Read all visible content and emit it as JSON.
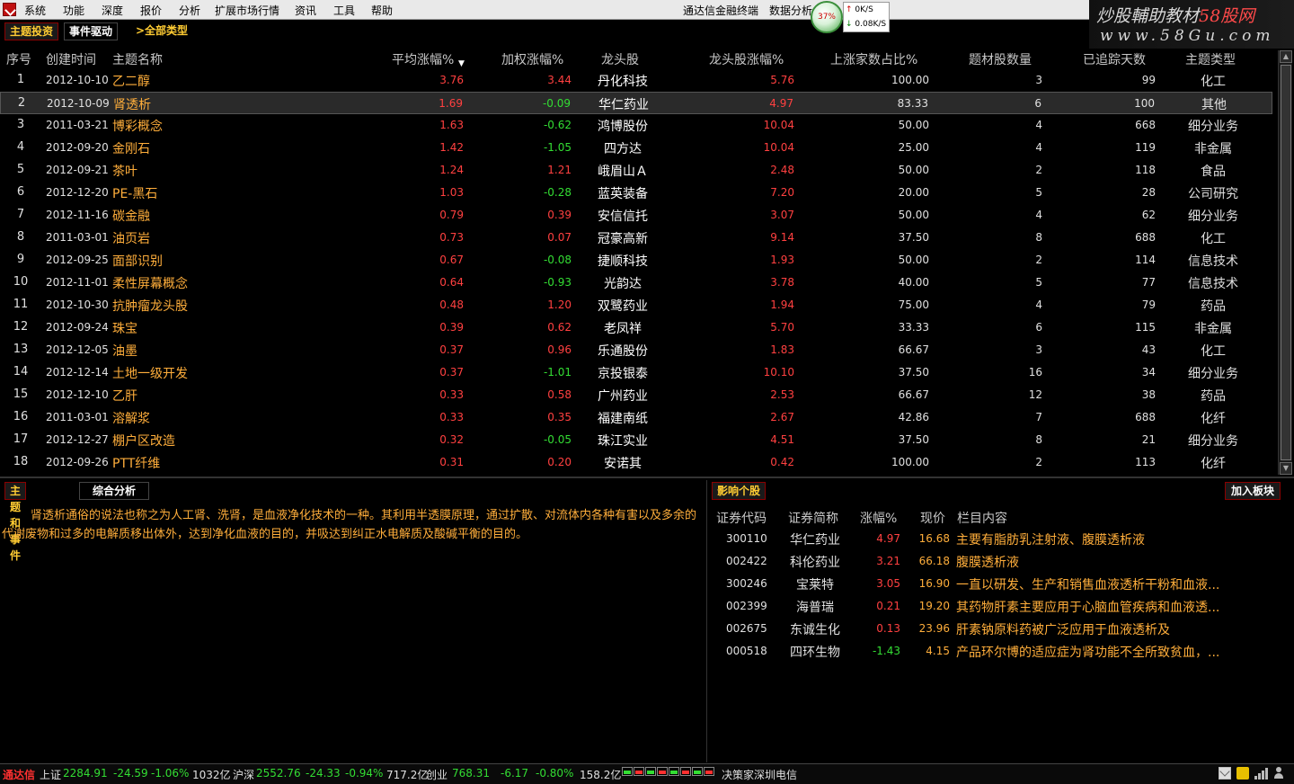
{
  "menu": {
    "items": [
      "系统",
      "功能",
      "深度",
      "报价",
      "分析",
      "扩展市场行情",
      "资讯",
      "工具",
      "帮助"
    ],
    "right_items": [
      "通达信金融终端",
      "数据分析"
    ],
    "speed_gauge": "37%",
    "speed_up": "0K/S",
    "speed_down": "0.08K/S"
  },
  "watermark": {
    "line1_a": "炒股輔助教材",
    "line1_b": "58",
    "line1_c": "股网",
    "line2": "www.58Gu.com"
  },
  "tabs": {
    "theme_invest": "主题投资",
    "event_driven": "事件驱动",
    "all_types": ">全部类型"
  },
  "table": {
    "headers": {
      "idx": "序号",
      "date": "创建时间",
      "name": "主题名称",
      "avg": "平均涨幅%",
      "weighted": "加权涨幅%",
      "leader": "龙头股",
      "leader_chg": "龙头股涨幅%",
      "up_ratio": "上涨家数占比%",
      "stock_count": "题材股数量",
      "days": "已追踪天数",
      "type": "主题类型"
    },
    "sort_arrow": "▼",
    "rows": [
      {
        "idx": "1",
        "date": "2012-10-10",
        "name": "乙二醇",
        "avg": "3.76",
        "weighted": "3.44",
        "wdir": "up",
        "leader": "丹化科技",
        "lchg": "5.76",
        "ratio": "100.00",
        "count": "3",
        "days": "99",
        "type": "化工"
      },
      {
        "idx": "2",
        "date": "2012-10-09",
        "name": "肾透析",
        "avg": "1.69",
        "weighted": "-0.09",
        "wdir": "down",
        "leader": "华仁药业",
        "lchg": "4.97",
        "ratio": "83.33",
        "count": "6",
        "days": "100",
        "type": "其他"
      },
      {
        "idx": "3",
        "date": "2011-03-21",
        "name": "博彩概念",
        "avg": "1.63",
        "weighted": "-0.62",
        "wdir": "down",
        "leader": "鸿博股份",
        "lchg": "10.04",
        "ratio": "50.00",
        "count": "4",
        "days": "668",
        "type": "细分业务"
      },
      {
        "idx": "4",
        "date": "2012-09-20",
        "name": "金刚石",
        "avg": "1.42",
        "weighted": "-1.05",
        "wdir": "down",
        "leader": "四方达",
        "lchg": "10.04",
        "ratio": "25.00",
        "count": "4",
        "days": "119",
        "type": "非金属"
      },
      {
        "idx": "5",
        "date": "2012-09-21",
        "name": "茶叶",
        "avg": "1.24",
        "weighted": "1.21",
        "wdir": "up",
        "leader": "峨眉山Ａ",
        "lchg": "2.48",
        "ratio": "50.00",
        "count": "2",
        "days": "118",
        "type": "食品"
      },
      {
        "idx": "6",
        "date": "2012-12-20",
        "name": "PE-黑石",
        "avg": "1.03",
        "weighted": "-0.28",
        "wdir": "down",
        "leader": "蓝英装备",
        "lchg": "7.20",
        "ratio": "20.00",
        "count": "5",
        "days": "28",
        "type": "公司研究"
      },
      {
        "idx": "7",
        "date": "2012-11-16",
        "name": "碳金融",
        "avg": "0.79",
        "weighted": "0.39",
        "wdir": "up",
        "leader": "安信信托",
        "lchg": "3.07",
        "ratio": "50.00",
        "count": "4",
        "days": "62",
        "type": "细分业务"
      },
      {
        "idx": "8",
        "date": "2011-03-01",
        "name": "油页岩",
        "avg": "0.73",
        "weighted": "0.07",
        "wdir": "up",
        "leader": "冠豪高新",
        "lchg": "9.14",
        "ratio": "37.50",
        "count": "8",
        "days": "688",
        "type": "化工"
      },
      {
        "idx": "9",
        "date": "2012-09-25",
        "name": "面部识别",
        "avg": "0.67",
        "weighted": "-0.08",
        "wdir": "down",
        "leader": "捷顺科技",
        "lchg": "1.93",
        "ratio": "50.00",
        "count": "2",
        "days": "114",
        "type": "信息技术"
      },
      {
        "idx": "10",
        "date": "2012-11-01",
        "name": "柔性屏幕概念",
        "avg": "0.64",
        "weighted": "-0.93",
        "wdir": "down",
        "leader": "光韵达",
        "lchg": "3.78",
        "ratio": "40.00",
        "count": "5",
        "days": "77",
        "type": "信息技术"
      },
      {
        "idx": "11",
        "date": "2012-10-30",
        "name": "抗肿瘤龙头股",
        "avg": "0.48",
        "weighted": "1.20",
        "wdir": "up",
        "leader": "双鹭药业",
        "lchg": "1.94",
        "ratio": "75.00",
        "count": "4",
        "days": "79",
        "type": "药品"
      },
      {
        "idx": "12",
        "date": "2012-09-24",
        "name": "珠宝",
        "avg": "0.39",
        "weighted": "0.62",
        "wdir": "up",
        "leader": "老凤祥",
        "lchg": "5.70",
        "ratio": "33.33",
        "count": "6",
        "days": "115",
        "type": "非金属"
      },
      {
        "idx": "13",
        "date": "2012-12-05",
        "name": "油墨",
        "avg": "0.37",
        "weighted": "0.96",
        "wdir": "up",
        "leader": "乐通股份",
        "lchg": "1.83",
        "ratio": "66.67",
        "count": "3",
        "days": "43",
        "type": "化工"
      },
      {
        "idx": "14",
        "date": "2012-12-14",
        "name": "土地一级开发",
        "avg": "0.37",
        "weighted": "-1.01",
        "wdir": "down",
        "leader": "京投银泰",
        "lchg": "10.10",
        "ratio": "37.50",
        "count": "16",
        "days": "34",
        "type": "细分业务"
      },
      {
        "idx": "15",
        "date": "2012-12-10",
        "name": "乙肝",
        "avg": "0.33",
        "weighted": "0.58",
        "wdir": "up",
        "leader": "广州药业",
        "lchg": "2.53",
        "ratio": "66.67",
        "count": "12",
        "days": "38",
        "type": "药品"
      },
      {
        "idx": "16",
        "date": "2011-03-01",
        "name": "溶解浆",
        "avg": "0.33",
        "weighted": "0.35",
        "wdir": "up",
        "leader": "福建南纸",
        "lchg": "2.67",
        "ratio": "42.86",
        "count": "7",
        "days": "688",
        "type": "化纤"
      },
      {
        "idx": "17",
        "date": "2012-12-27",
        "name": "棚户区改造",
        "avg": "0.32",
        "weighted": "-0.05",
        "wdir": "down",
        "leader": "珠江实业",
        "lchg": "4.51",
        "ratio": "37.50",
        "count": "8",
        "days": "21",
        "type": "细分业务"
      },
      {
        "idx": "18",
        "date": "2012-09-26",
        "name": "PTT纤维",
        "avg": "0.31",
        "weighted": "0.20",
        "wdir": "up",
        "leader": "安诺其",
        "lchg": "0.42",
        "ratio": "100.00",
        "count": "2",
        "days": "113",
        "type": "化纤"
      }
    ]
  },
  "left_panel": {
    "tab_theme_event": "主题和事件",
    "tab_analysis": "综合分析",
    "description": "肾透析通俗的说法也称之为人工肾、洗肾，是血液净化技术的一种。其利用半透膜原理，通过扩散、对流体内各种有害以及多余的代谢废物和过多的电解质移出体外，达到净化血液的目的，并吸达到纠正水电解质及酸碱平衡的目的。"
  },
  "right_panel": {
    "title": "影响个股",
    "add_button": "加入板块",
    "headers": {
      "code": "证券代码",
      "name": "证券简称",
      "chg": "涨幅%",
      "price": "现价",
      "content": "栏目内容"
    },
    "rows": [
      {
        "code": "300110",
        "name": "华仁药业",
        "chg": "4.97",
        "dir": "up",
        "price": "16.68",
        "content": "主要有脂肪乳注射液、腹膜透析液"
      },
      {
        "code": "002422",
        "name": "科伦药业",
        "chg": "3.21",
        "dir": "up",
        "price": "66.18",
        "content": "腹膜透析液"
      },
      {
        "code": "300246",
        "name": "宝莱特",
        "chg": "3.05",
        "dir": "up",
        "price": "16.90",
        "content": "一直以研发、生产和销售血液透析干粉和血液..."
      },
      {
        "code": "002399",
        "name": "海普瑞",
        "chg": "0.21",
        "dir": "up",
        "price": "19.20",
        "content": "其药物肝素主要应用于心脑血管疾病和血液透..."
      },
      {
        "code": "002675",
        "name": "东诚生化",
        "chg": "0.13",
        "dir": "up",
        "price": "23.96",
        "content": "肝素钠原料药被广泛应用于血液透析及"
      },
      {
        "code": "000518",
        "name": "四环生物",
        "chg": "-1.43",
        "dir": "down",
        "price": "4.15",
        "content": "产品环尔博的适应症为肾功能不全所致贫血，..."
      }
    ]
  },
  "statusbar": {
    "brand": "通达信",
    "sh_label": "上证",
    "sh_price": "2284.91",
    "sh_chg": "-24.59",
    "sh_pct": "-1.06%",
    "sh_vol": "1032亿",
    "hs_label": "沪深",
    "hs_price": "2552.76",
    "hs_chg": "-24.33",
    "hs_pct": "-0.94%",
    "hs_vol": "717.2亿",
    "cy_label": "创业",
    "cy_price": "768.31",
    "cy_chg": "-6.17",
    "cy_pct": "-0.80%",
    "cy_vol": "158.2亿",
    "ticker": "决策家深圳电信"
  },
  "colors": {
    "up": "#ff4040",
    "down": "#33dd33",
    "theme_name": "#ffae3b",
    "tab_active": "#ffcc33"
  }
}
